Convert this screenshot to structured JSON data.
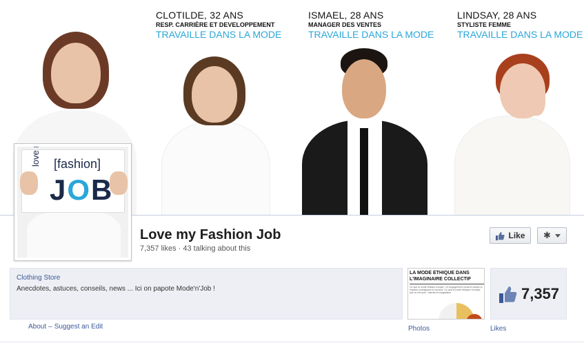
{
  "cover": {
    "people": [
      {
        "name": "CLOTILDE, 32 ANS",
        "role": "RESP. CARRIÈRE ET DEVELOPPEMENT",
        "tag": "TRAVAILLE DANS LA MODE"
      },
      {
        "name": "ISMAEL, 28 ANS",
        "role": "MANAGER DES VENTES",
        "tag": "TRAVAILLE DANS LA MODE"
      },
      {
        "name": "LINDSAY, 28 ANS",
        "role": "STYLISTE FEMME",
        "tag": "TRAVAILLE DANS LA MODE"
      }
    ]
  },
  "profile": {
    "logo_love": "love my",
    "logo_fashion": "[fashion]",
    "logo_j": "J",
    "logo_o": "O",
    "logo_b": "B"
  },
  "page": {
    "name": "Love my Fashion Job",
    "stats": "7,357 likes · 43 talking about this"
  },
  "actions": {
    "like_label": "Like",
    "like_icon": "thumbs-up-icon",
    "settings_icon": "gear-icon"
  },
  "about": {
    "category": "Clothing Store",
    "description": "Anecdotes, astuces, conseils, news ... Ici on papote Mode'n'Job !",
    "link_about": "About",
    "separator": "–",
    "link_suggest": "Suggest an Edit"
  },
  "photos": {
    "headline": "LA MODE ETHIQUE DANS L'IMAGINAIRE COLLECTIF",
    "body_text": "Ce que la mode éthique évoque : un engagement moral et citoyen à impacts écologiques et sociaux. Ce que la mode éthique n'évoque pas ou très peu : talents et imagination.",
    "label": "Photos"
  },
  "likes": {
    "count": "7,357",
    "label": "Likes"
  },
  "colors": {
    "accent_blue": "#2aa7d8",
    "link_blue": "#3b5998",
    "panel_bg": "#edeff4"
  }
}
